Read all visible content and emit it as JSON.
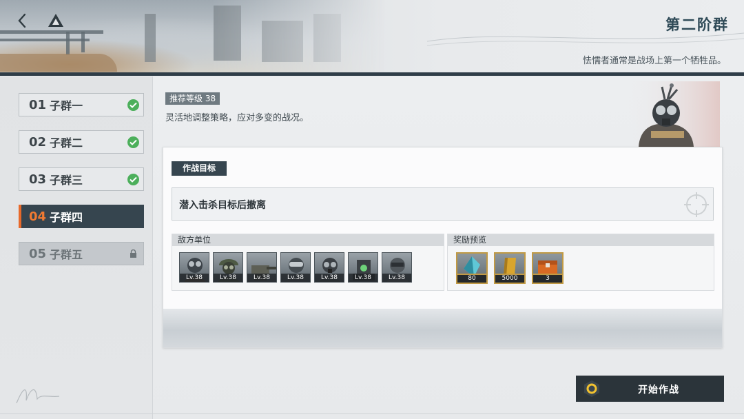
{
  "header": {
    "stage_title": "第二阶群",
    "stage_subtitle": "怯懦者通常是战场上第一个牺牲品。"
  },
  "sidebar": {
    "items": [
      {
        "num": "01",
        "label": "子群一",
        "state": "cleared"
      },
      {
        "num": "02",
        "label": "子群二",
        "state": "cleared"
      },
      {
        "num": "03",
        "label": "子群三",
        "state": "cleared"
      },
      {
        "num": "04",
        "label": "子群四",
        "state": "selected"
      },
      {
        "num": "05",
        "label": "子群五",
        "state": "locked"
      }
    ]
  },
  "stage_info": {
    "recommended_level": "推荐等级 38",
    "description": "灵活地调整策略，应对多变的战况。"
  },
  "objective": {
    "label": "作战目标",
    "text": "潜入击杀目标后撤离"
  },
  "enemies": {
    "label": "敌方单位",
    "units": [
      {
        "level": "Lv.38",
        "icon": "gasmask-soldier-icon"
      },
      {
        "level": "Lv.38",
        "icon": "helmet-soldier-icon"
      },
      {
        "level": "Lv.38",
        "icon": "turret-icon"
      },
      {
        "level": "Lv.38",
        "icon": "goggle-soldier-icon"
      },
      {
        "level": "Lv.38",
        "icon": "gasmask-trooper-icon"
      },
      {
        "level": "Lv.38",
        "icon": "mech-drone-icon"
      },
      {
        "level": "Lv.38",
        "icon": "armored-soldier-icon"
      }
    ]
  },
  "rewards": {
    "label": "奖励预览",
    "items": [
      {
        "amount": "80",
        "icon": "crystal-icon"
      },
      {
        "amount": "5000",
        "icon": "gold-bar-icon"
      },
      {
        "amount": "3",
        "icon": "supply-crate-icon"
      }
    ]
  },
  "actions": {
    "start_label": "开始作战"
  },
  "colors": {
    "accent_orange": "#e8692a",
    "dark_panel": "#36454f",
    "check_green": "#4caf5b",
    "reward_gold": "#c19a45"
  }
}
